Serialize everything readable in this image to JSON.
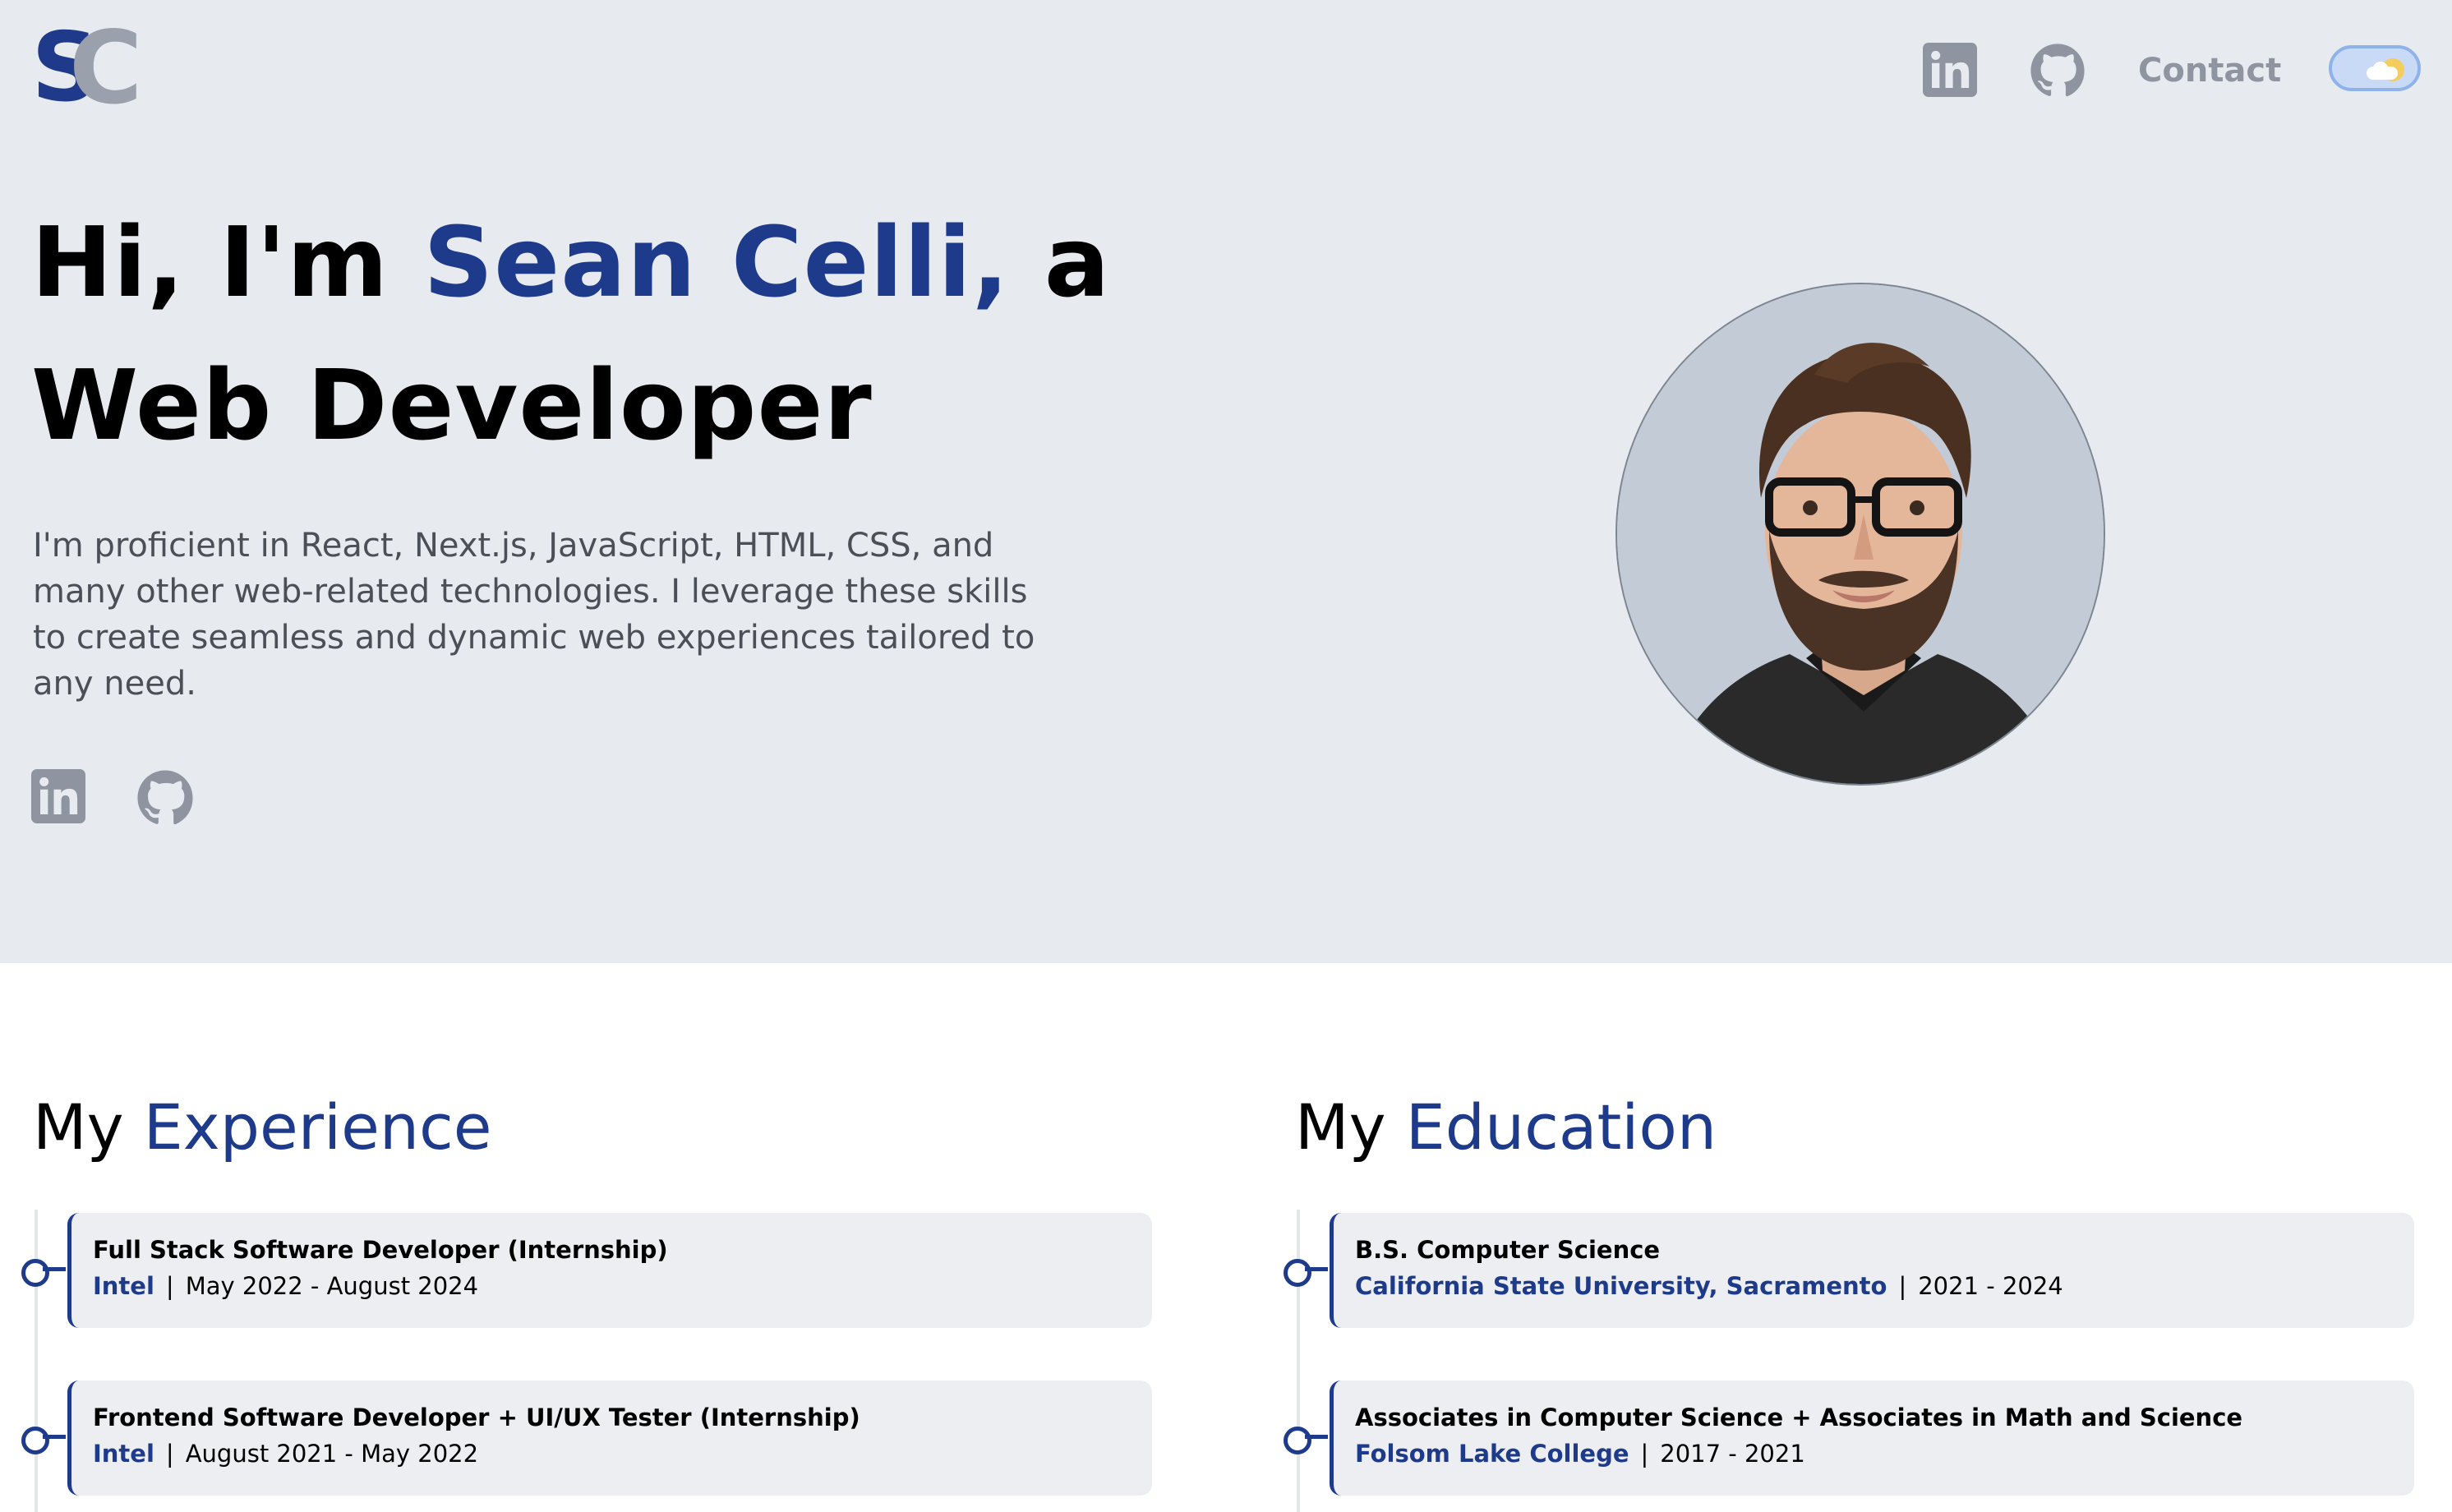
{
  "header": {
    "logo": {
      "letter1": "S",
      "letter2": "C"
    },
    "nav": {
      "contact_label": "Contact"
    }
  },
  "hero": {
    "headline_pre": "Hi, I'm ",
    "name": "Sean Celli,",
    "headline_post": " a",
    "role": "Web Developer",
    "intro": "I'm proficient in React, Next.js, JavaScript, HTML, CSS, and many other web-related technologies. I leverage these skills to create seamless and dynamic web experiences tailored to any need."
  },
  "experience": {
    "title_pre": "My ",
    "title_accent": "Experience",
    "items": [
      {
        "title": "Full Stack Software Developer (Internship)",
        "org": "Intel",
        "sep": "|",
        "dates": "May 2022 - August 2024"
      },
      {
        "title": "Frontend Software Developer + UI/UX Tester (Internship)",
        "org": "Intel",
        "sep": "|",
        "dates": "August 2021 - May 2022"
      }
    ]
  },
  "education": {
    "title_pre": "My ",
    "title_accent": "Education",
    "items": [
      {
        "title": "B.S. Computer Science",
        "org": "California State University, Sacramento",
        "sep": "|",
        "dates": "2021 - 2024"
      },
      {
        "title": "Associates in Computer Science + Associates in Math and Science",
        "org": "Folsom Lake College",
        "sep": "|",
        "dates": "2017 - 2021"
      }
    ]
  },
  "colors": {
    "accent": "#1e3a8a",
    "hero_bg": "#e7eaef",
    "icon_gray": "#8f95a0"
  },
  "icons": [
    "linkedin-icon",
    "github-icon",
    "theme-toggle"
  ]
}
